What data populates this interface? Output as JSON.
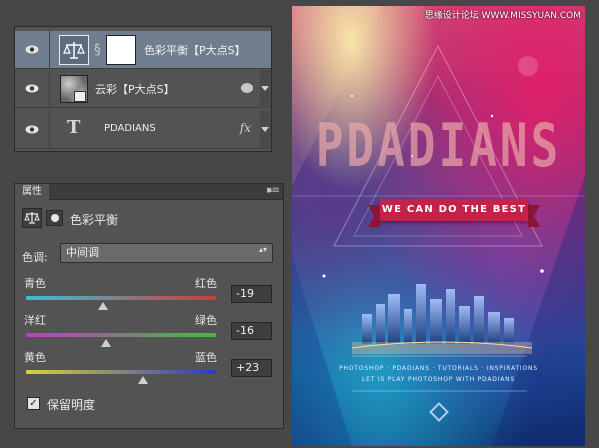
{
  "layers": {
    "items": [
      {
        "name": "色彩平衡【P大点S】",
        "type": "adjustment"
      },
      {
        "name": "云彩【P大点S】",
        "type": "smart-object"
      },
      {
        "name": "PDADIANS",
        "type": "text",
        "icon": "T",
        "fx": "fx"
      }
    ]
  },
  "properties": {
    "tab_label": "属性",
    "collapse_icon": "▸▸",
    "menu_icon": "▾≡",
    "adjustment_title": "色彩平衡",
    "tone_label": "色调:",
    "tone_value": "中间调",
    "tone_arrows": "▴▾",
    "sliders": [
      {
        "left": "青色",
        "right": "红色",
        "value": "-19",
        "numeric": -19,
        "gradient": [
          "#35c3d3",
          "#d13a3a"
        ]
      },
      {
        "left": "洋红",
        "right": "绿色",
        "value": "-16",
        "numeric": -16,
        "gradient": [
          "#c339c3",
          "#3dc03d"
        ]
      },
      {
        "left": "黄色",
        "right": "蓝色",
        "value": "+23",
        "numeric": 23,
        "gradient": [
          "#d9d231",
          "#2d39c9"
        ]
      }
    ],
    "preserve_luminosity_label": "保留明度",
    "preserve_luminosity_checked": true
  },
  "poster": {
    "watermark": "思缘设计论坛 WWW.MISSYUAN.COM",
    "title": "PDADIANS",
    "ribbon_text": "WE CAN DO THE BEST",
    "footer_line1": "PHOTOSHOP · PDADIANS · TUTORIALS · INSPIRATIONS",
    "footer_line2": "LET IS PLAY PHOTOSHOP WITH PDADIANS"
  },
  "colors": {
    "panel_bg": "#535353",
    "selected_layer_bg": "#6f7d8e",
    "ribbon": "#c42249"
  }
}
